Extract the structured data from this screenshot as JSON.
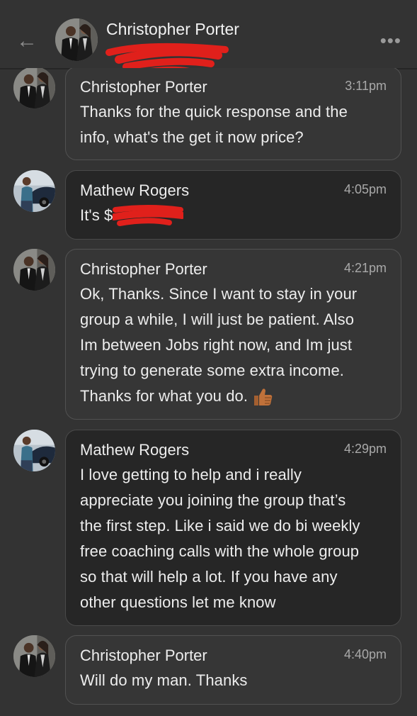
{
  "header": {
    "back_icon": "arrow-left-icon",
    "title": "Christopher Porter",
    "more_icon": "more-horizontal-icon",
    "more_glyph": "•••",
    "back_glyph": "←"
  },
  "colors": {
    "background": "#333333",
    "bubble_light": "#363636",
    "bubble_dark": "#262626",
    "bubble_border": "#525252",
    "redaction": "#e0201b",
    "thumb": "#c0713a"
  },
  "messages": [
    {
      "sender": "Christopher Porter",
      "time": "3:11pm",
      "lines": [
        "Thanks for the quick response and the",
        "info, what's the get it now price?"
      ]
    },
    {
      "sender": "Mathew Rogers",
      "time": "4:05pm",
      "lines": [
        "It's $"
      ]
    },
    {
      "sender": "Christopher Porter",
      "time": "4:21pm",
      "lines": [
        "Ok, Thanks. Since I want to stay in your",
        "group a while, I will just be patient. Also",
        "Im between Jobs right now, and Im just",
        "trying to generate some extra income.",
        "Thanks for what you do."
      ],
      "emoji": "thumbs-up-icon"
    },
    {
      "sender": "Mathew Rogers",
      "time": "4:29pm",
      "lines": [
        "I love getting to help and i really",
        "appreciate you joining the group that’s",
        "the first step. Like i said we do bi weekly",
        "free coaching calls with the whole group",
        "so that will help a lot. If you have any",
        "other questions let me know"
      ]
    },
    {
      "sender": "Christopher Porter",
      "time": "4:40pm",
      "lines": [
        "Will do my man. Thanks"
      ]
    }
  ]
}
